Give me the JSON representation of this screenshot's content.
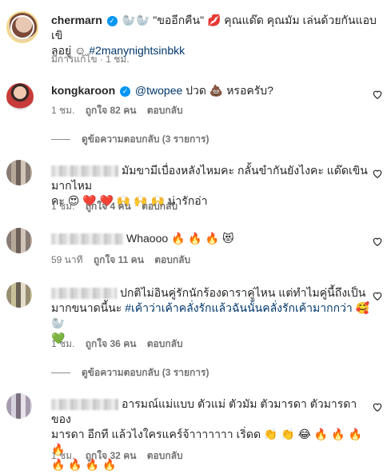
{
  "post": {
    "username": "chermarn",
    "caption_line1": "🦭🦭 \"ขออีกคืน\" 💋 คุณแด๊ด คุณมัม เล่นด้วยกันแอบเขิ",
    "caption_line2": "ลอยู่ ☺ ",
    "hashtag": "#2manynightsinbkk",
    "meta": "มีการแก้ไข · 1 ชม."
  },
  "comments": [
    {
      "username": "kongkaroon",
      "mention": "@twopee",
      "text": " ปวด 💩 หรอครับ?",
      "time": "1 ชม.",
      "likes": "ถูกใจ 82 คน",
      "reply": "ตอบกลับ",
      "view_replies": "ดูข้อความตอบกลับ (3 รายการ)"
    },
    {
      "line1": "มัมขามีเบื่องหลังไหมคะ กลั้นขำกันยังไงคะ แด๊ดเขินมากไหม",
      "line2": "คะ 😍 ❤️ ❤️ 🙌 🙌 🙌  น่ารักอ่า",
      "time": "1 ชม.",
      "likes": "ถูกใจ 4 คน",
      "reply": "ตอบกลับ"
    },
    {
      "line1": "Whaooo 🔥 🔥 🔥 😻",
      "time": "59 นาที",
      "likes": "ถูกใจ 11 คน",
      "reply": "ตอบกลับ"
    },
    {
      "line1": "ปกติไม่อินคู่รักนักร้องดาราคู่ไหน แต่ทำไมคู่นี้ถึงเป็น",
      "line2_text": "มากขนาดนี้นะ ",
      "line2_tag": "#เค้าว่าเค้าคลั่งรักแล้วฉันนั้นคลั่งรักเค้ามากกว่า",
      "line2_emoji": " 🥰 🦭",
      "line3": "💚",
      "time": "1 ชม.",
      "likes": "ถูกใจ 36 คน",
      "reply": "ตอบกลับ",
      "view_replies": "ดูข้อความตอบกลับ (3 รายการ)"
    },
    {
      "line1": "อารมณ์แม่แบบ ตัวแม่ ตัวมัม ตัวมารดา ตัวมารดาของ",
      "line2": "มารดา อีกที แล้วไงใครแคร์จ้าาาาาาา เริ่ดด 👏 👏 😂 🔥 🔥 🔥 🔥",
      "line3": "🔥 🔥 🔥 🔥",
      "time": "1 ชม.",
      "likes": "ถูกใจ 32 คน",
      "reply": "ตอบกลับ"
    }
  ]
}
